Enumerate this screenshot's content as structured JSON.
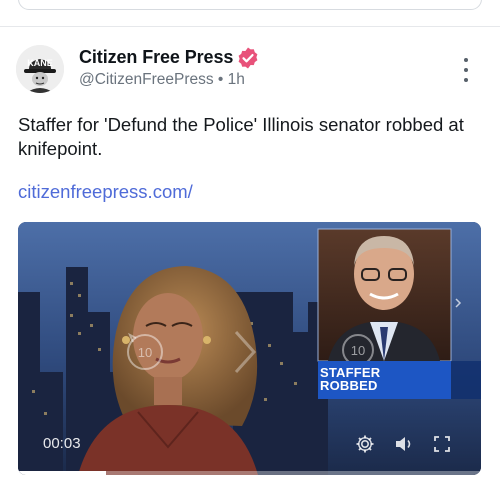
{
  "post": {
    "author": {
      "name": "Citizen Free Press",
      "handle": "@CitizenFreePress",
      "time": "1h",
      "avatar_text": "KANE"
    },
    "text": "Staffer for 'Defund the Police' Illinois senator robbed at knifepoint.",
    "link": "citizenfreepress.com/"
  },
  "video": {
    "inset_label_line1": "STAFFER",
    "inset_label_line2": "ROBBED",
    "skip_back_label": "10",
    "skip_forward_label": "10",
    "timecode": "00:03",
    "progress": 0.19
  },
  "colors": {
    "verified": "#e8527a",
    "link": "#4f6bd8",
    "inset_label_bg": "#1d56c4"
  },
  "icons": {
    "verified": "verified-badge-icon",
    "more": "more-vertical-icon",
    "settings": "gear-icon",
    "volume": "volume-icon",
    "fullscreen": "fullscreen-icon"
  }
}
